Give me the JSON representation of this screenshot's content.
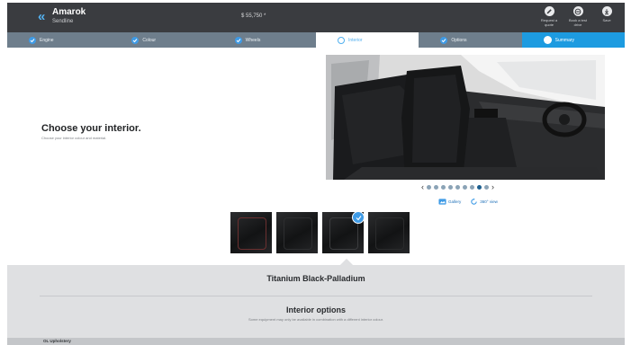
{
  "header": {
    "model_name": "Amarok",
    "variant": "Sendline",
    "price": "$ 55,750 *",
    "actions": [
      {
        "label": "Request a quote",
        "icon": "edit-icon"
      },
      {
        "label": "Book a test drive",
        "icon": "steering-wheel-icon"
      },
      {
        "label": "Save",
        "icon": "save-icon"
      }
    ]
  },
  "steps": [
    {
      "label": "Engine",
      "state": "done"
    },
    {
      "label": "Colour",
      "state": "done"
    },
    {
      "label": "Wheels",
      "state": "done"
    },
    {
      "label": "Interior",
      "state": "current"
    },
    {
      "label": "Options",
      "state": "done"
    },
    {
      "label": "Summary",
      "state": "summary"
    }
  ],
  "main": {
    "heading": "Choose your interior.",
    "subheading": "Choose your interior colour and material."
  },
  "gallery": {
    "page_count": 9,
    "active_page": 8,
    "gallery_label": "Gallery",
    "view360_label": "360° view"
  },
  "swatches": [
    {
      "name": "swatch-1",
      "selected": false,
      "accent": "#6b3030"
    },
    {
      "name": "swatch-2",
      "selected": false,
      "accent": "#1c1d1f"
    },
    {
      "name": "swatch-3",
      "selected": true,
      "accent": "#3b3c3e"
    },
    {
      "name": "swatch-4",
      "selected": false,
      "accent": "#2a2b2c"
    }
  ],
  "bottom": {
    "selected_color_name": "Titanium Black-Palladium",
    "options_title": "Interior options",
    "options_note": "Some equipment may only be available in combination with a different interior colour.",
    "footer_label": "OL Upholstery"
  },
  "colors": {
    "header_bg": "#3a3c40",
    "steps_bg": "#6e7e8c",
    "accent_blue": "#1d9be0",
    "panel_bg": "#dfe0e2"
  }
}
